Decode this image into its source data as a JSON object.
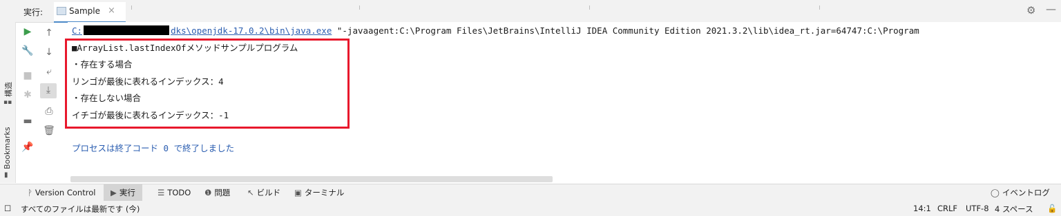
{
  "run_tool": {
    "label": "実行:",
    "tab_name": "Sample",
    "tab_close": "×"
  },
  "side_strip": {
    "structure": "構造",
    "bookmarks": "Bookmarks"
  },
  "console": {
    "command": {
      "prefix": "C:",
      "link_rest": "dks\\openjdk-17.0.2\\bin\\java.exe",
      "args": " \"-javaagent:C:\\Program Files\\JetBrains\\IntelliJ IDEA Community Edition 2021.3.2\\lib\\idea_rt.jar=64747:C:\\Program"
    },
    "lines": [
      "■ArrayList.lastIndexOfメソッドサンプルプログラム",
      "・存在する場合",
      "リンゴが最後に表れるインデックス：4",
      "・存在しない場合",
      "イチゴが最後に表れるインデックス：-1"
    ],
    "exit_message": "プロセスは終了コード 0 で終了しました"
  },
  "bottom_tabs": {
    "version_control": "Version Control",
    "run": "実行",
    "todo": "TODO",
    "problems": "問題",
    "build": "ビルド",
    "terminal": "ターミナル",
    "event_log": "イベントログ"
  },
  "status_bar": {
    "message": "すべてのファイルは最新です (今)",
    "position": "14:1",
    "line_sep": "CRLF",
    "encoding": "UTF-8",
    "indent": "4 スペース"
  },
  "colors": {
    "highlight_box": "#e8182c",
    "link": "#2a5db0",
    "exit_message": "#2a5db0"
  }
}
